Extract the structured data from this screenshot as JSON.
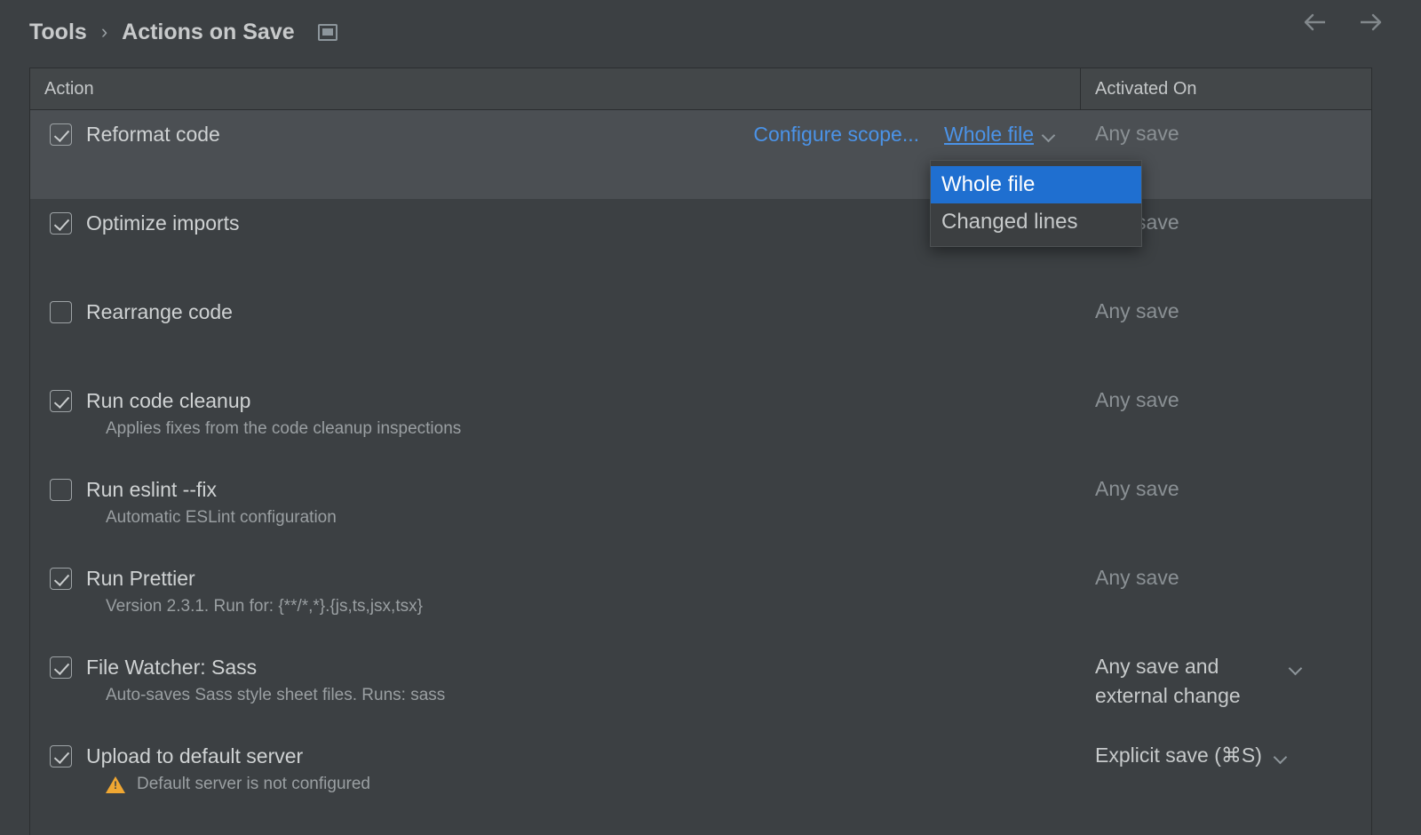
{
  "header": {
    "breadcrumb": [
      {
        "label": "Tools"
      },
      {
        "label": "Actions on Save"
      }
    ],
    "separator": "›",
    "dialog_icon": "dialog-window-icon",
    "back_icon": "arrow-left-icon",
    "forward_icon": "arrow-right-icon"
  },
  "table": {
    "columns": {
      "action": "Action",
      "activated_on": "Activated On"
    },
    "rows": [
      {
        "label": "Reformat code",
        "checked": true,
        "description": "",
        "selected": true,
        "configure_link": "Configure scope...",
        "scope_value": "Whole file",
        "activated": "Any save",
        "activated_bright": false,
        "has_chevron": false
      },
      {
        "label": "Optimize imports",
        "checked": true,
        "description": "",
        "selected": false,
        "activated": "Any save",
        "activated_bright": false,
        "has_chevron": false
      },
      {
        "label": "Rearrange code",
        "checked": false,
        "description": "",
        "selected": false,
        "activated": "Any save",
        "activated_bright": false,
        "has_chevron": false
      },
      {
        "label": "Run code cleanup",
        "checked": true,
        "description": "Applies fixes from the code cleanup inspections",
        "selected": false,
        "activated": "Any save",
        "activated_bright": false,
        "has_chevron": false
      },
      {
        "label": "Run eslint --fix",
        "checked": false,
        "description": "Automatic ESLint configuration",
        "selected": false,
        "activated": "Any save",
        "activated_bright": false,
        "has_chevron": false
      },
      {
        "label": "Run Prettier",
        "checked": true,
        "description": "Version 2.3.1. Run for: {**/*,*}.{js,ts,jsx,tsx}",
        "selected": false,
        "activated": "Any save",
        "activated_bright": false,
        "has_chevron": false
      },
      {
        "label": "File Watcher: Sass",
        "checked": true,
        "description": "Auto-saves Sass style sheet files. Runs: sass",
        "selected": false,
        "activated": "Any save and external change",
        "activated_bright": true,
        "has_chevron": true
      },
      {
        "label": "Upload to default server",
        "checked": true,
        "description": "Default server is not configured",
        "description_warning": true,
        "selected": false,
        "activated": "Explicit save (⌘S)",
        "activated_bright": true,
        "has_chevron": true
      }
    ]
  },
  "dropdown": {
    "open": true,
    "items": [
      {
        "label": "Whole file",
        "selected": true
      },
      {
        "label": "Changed lines",
        "selected": false
      }
    ]
  },
  "colors": {
    "background": "#3c4043",
    "row_selected": "#4b4f53",
    "accent_link": "#4b93e8",
    "accent_highlight": "#1f6fd0",
    "text_primary": "#cfd2d3",
    "text_muted": "#8a9094",
    "warning": "#f0a732",
    "border": "#2b2e30"
  }
}
